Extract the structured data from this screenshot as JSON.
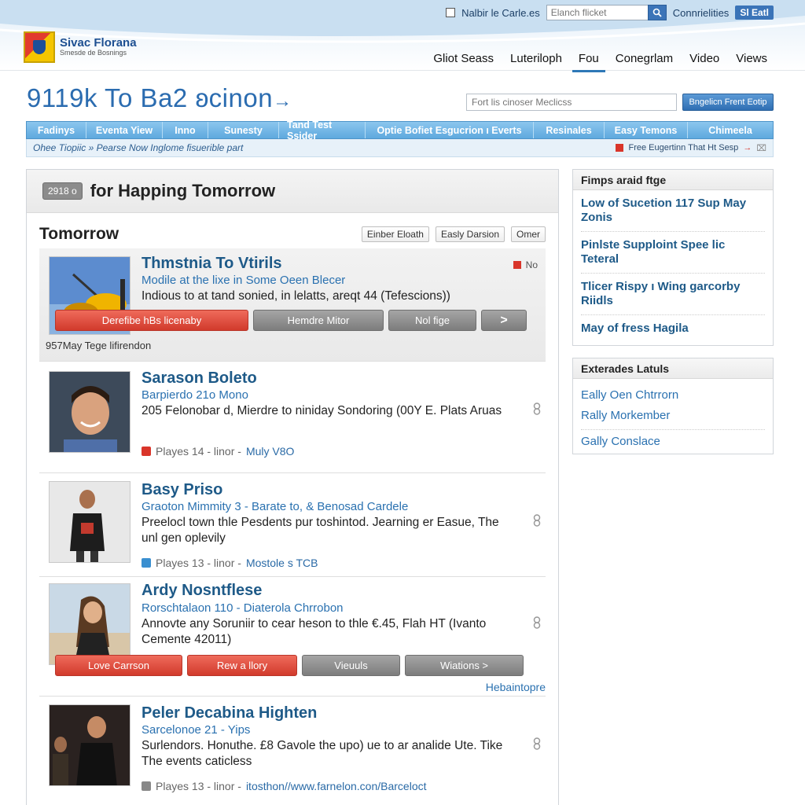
{
  "site": {
    "logo_title": "Sivac Florana",
    "logo_sub": "Smesde de Bosnings"
  },
  "top_util": {
    "checkbox_label": "Nalbir le Carle.es",
    "search_placeholder": "Elanch flicket",
    "link": "Connrielities",
    "button": "Sl Eatl"
  },
  "main_nav": [
    "Gliot Seass",
    "Luteriloph",
    "Fou",
    "Conegrlam",
    "Video",
    "Views"
  ],
  "page": {
    "title": "9119k To Ba2 ʚcinon",
    "search_placeholder": "Fort lis cinoser Meclicss",
    "search_button": "Bngelicn Frent Eotip"
  },
  "tabs": [
    "Fadinys",
    "Eventa Yiew",
    "Inno",
    "Sunesty",
    "Tand Test Ssider",
    "Optie Bofiet Esgucrion ı Everts",
    "Resinales",
    "Easy Temons",
    "Chimeela"
  ],
  "subbar": {
    "left": "Ohee Tiopiic » Pearse Now Inglome fisuerible part",
    "right": "Free Eugertinn That Ht Sesp"
  },
  "panel": {
    "date_badge": "2918 o",
    "title": "for Happing Tomorrow",
    "section_title": "Tomorrow",
    "filters": [
      "Einber Eloath",
      "Easly Darsion",
      "Omer"
    ]
  },
  "featured": {
    "title": "Thmstnia To Vtirils",
    "subtitle": "Modile at the lixe in Some Oeen Blecer",
    "desc": "Indious to at tand sonied, in lelatts, areqt 44 (Tefescions))",
    "tag": "No",
    "caption": "957May Tege lifirendon",
    "buttons": [
      "Derefibe hBs licenaby",
      "Hemdre Mitor",
      "Nol fige",
      ">"
    ]
  },
  "items": [
    {
      "title": "Sarason Boleto",
      "subtitle": "Barpierdo 21o Mono",
      "desc": "205 Felonobar d, Mierdre to niniday Sondoring (00Y E. Plats Aruas",
      "meta_label": "Playes 14 - linor -",
      "meta_link": "Muly V8O"
    },
    {
      "title": "Basy Priso",
      "subtitle": "Graoton Mimmity 3 - Barate to, & Benosad Cardele",
      "desc": "Preelocl town thle Pesdents pur toshintod. Jearning er Easue, The unl gen oplevily",
      "meta_label": "Playes 13 - linor -",
      "meta_link": "Mostole s TCB"
    },
    {
      "title": "Ardy Nosntflese",
      "subtitle": "Rorschtalaon 110 - Diaterola Chrrobon",
      "desc": "Annovte any Soruniir to cear heson to thle €.45, Flah HT (Ivanto Cemente 42011)",
      "buttons": [
        "Love Carrson",
        "Rew a llory",
        "Vieuuls",
        "Wiations >"
      ],
      "more_link": "Hebaintopre"
    },
    {
      "title": "Peler Decabina Highten",
      "subtitle": "Sarcelonoe 21 - Yips",
      "desc": "Surlendors. Honuthe. £8 Gavole the upo) ue to ar analide Ute. Tike The events caticless",
      "meta_label": "Playes 13 - linor -",
      "meta_link": "itosthon//www.farnelon.con/Barceloct"
    }
  ],
  "sidebar": {
    "box1_title": "Fimps araid ftge",
    "box1_links": [
      "Low of Sucetion 117 Sup May Zonis",
      "Pinlste Supploint Spee lic Teteral",
      "Tlicer Rispy ı Wing garcorby Riidls",
      "May of fress Hagila"
    ],
    "box2_title": "Exterades Latuls",
    "box2_links": [
      "Eally Oen Chtrrorn",
      "Rally Morkember",
      "Gally Conslace"
    ]
  },
  "colors": {
    "accent_blue": "#2b6cb0",
    "tab_blue": "#5ea9de",
    "button_red": "#d13a2c",
    "button_gray": "#7d7d7d"
  }
}
